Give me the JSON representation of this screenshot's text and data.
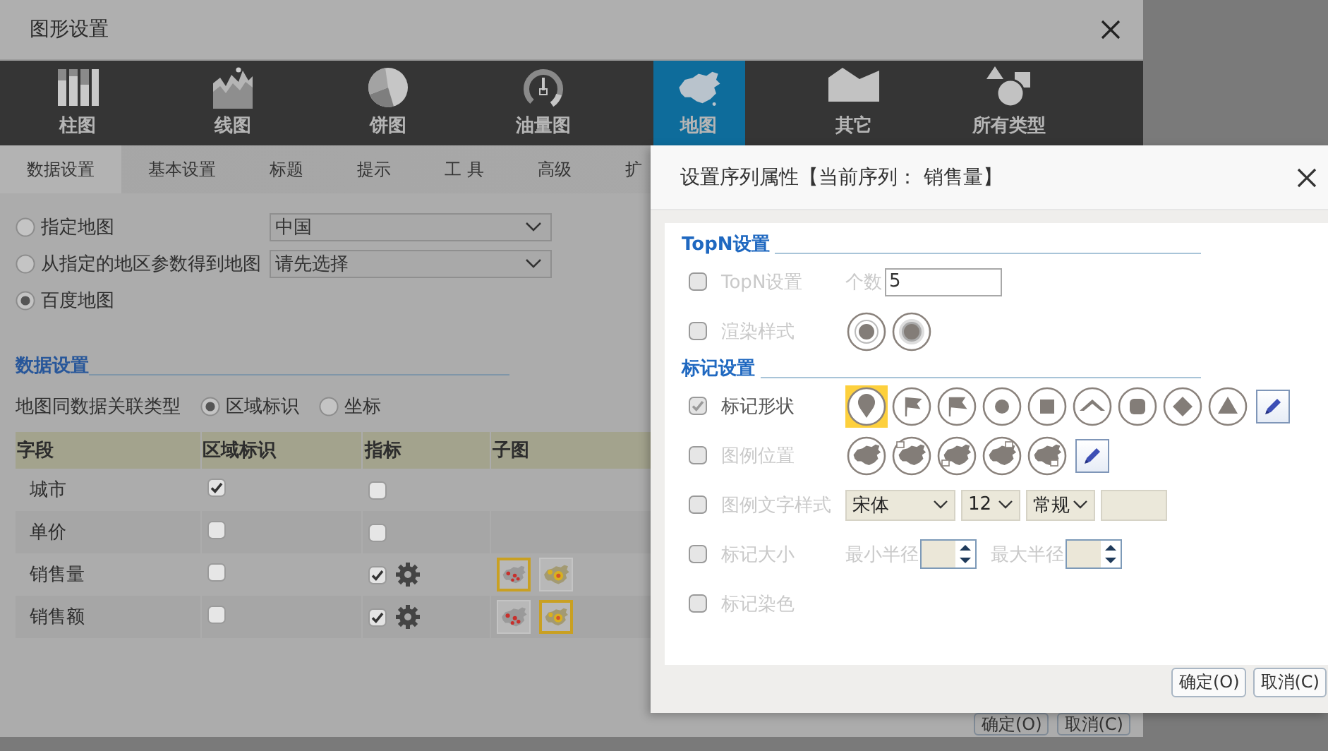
{
  "background_dialog": {
    "title": "图形设置",
    "chart_types": [
      {
        "kind": "bar",
        "label": "柱图",
        "selected": false
      },
      {
        "kind": "line",
        "label": "线图",
        "selected": false
      },
      {
        "kind": "pie",
        "label": "饼图",
        "selected": false
      },
      {
        "kind": "gauge",
        "label": "油量图",
        "selected": false
      },
      {
        "kind": "map",
        "label": "地图",
        "selected": true
      },
      {
        "kind": "other",
        "label": "其它",
        "selected": false
      },
      {
        "kind": "all",
        "label": "所有类型",
        "selected": false
      }
    ],
    "tabs": [
      {
        "label": "数据设置",
        "selected": true
      },
      {
        "label": "基本设置",
        "selected": false
      },
      {
        "label": "标题",
        "selected": false
      },
      {
        "label": "提示",
        "selected": false
      },
      {
        "label": "工 具",
        "selected": false
      },
      {
        "label": "高级",
        "selected": false
      },
      {
        "label": "扩",
        "selected": false
      }
    ],
    "map_sources": [
      {
        "label": "指定地图",
        "selected": false,
        "dropdown": "中国"
      },
      {
        "label": "从指定的地区参数得到地图",
        "selected": false,
        "dropdown": "请先选择"
      },
      {
        "label": "百度地图",
        "selected": true
      }
    ],
    "data_section": {
      "title": "数据设置",
      "link_type_label": "地图同数据关联类型",
      "link_types": [
        {
          "label": "区域标识",
          "selected": true
        },
        {
          "label": "坐标",
          "selected": false
        }
      ]
    },
    "table": {
      "columns": [
        "字段",
        "区域标识",
        "指标",
        "子图"
      ],
      "rows": [
        {
          "field": "城市",
          "region": true,
          "indicator": false
        },
        {
          "field": "单价",
          "region": false,
          "indicator": false
        },
        {
          "field": "销售量",
          "region": false,
          "indicator": true,
          "subcharts": [
            {
              "kind": "points",
              "selected": true
            },
            {
              "kind": "heat",
              "selected": false
            }
          ]
        },
        {
          "field": "销售额",
          "region": false,
          "indicator": true,
          "subcharts": [
            {
              "kind": "points",
              "selected": false
            },
            {
              "kind": "heat",
              "selected": true
            }
          ]
        }
      ]
    },
    "buttons": [
      "确定(O)",
      "取消(C)"
    ]
  },
  "series_dialog": {
    "title": "设置序列属性【当前序列： 销售量】",
    "sections": [
      {
        "title": "TopN设置",
        "rows": [
          {
            "kind": "topn",
            "label": "TopN设置",
            "checked": false,
            "count_label": "个数",
            "count_value": "5"
          },
          {
            "kind": "render",
            "label": "渲染样式",
            "checked": false,
            "options": [
              {
                "kind": "ring"
              },
              {
                "kind": "glow"
              }
            ]
          }
        ]
      },
      {
        "title": "标记设置",
        "rows": [
          {
            "kind": "shape",
            "label": "标记形状",
            "checked": true,
            "options": [
              {
                "kind": "pin",
                "selected": true
              },
              {
                "kind": "flag",
                "selected": false
              },
              {
                "kind": "pennant",
                "selected": false
              },
              {
                "kind": "circle",
                "selected": false
              },
              {
                "kind": "square",
                "selected": false
              },
              {
                "kind": "chevron",
                "selected": false
              },
              {
                "kind": "rounded",
                "selected": false
              },
              {
                "kind": "diamond",
                "selected": false
              },
              {
                "kind": "triangle",
                "selected": false
              }
            ]
          },
          {
            "kind": "legend_position",
            "label": "图例位置",
            "checked": false,
            "options": [
              {
                "kind": "none"
              },
              {
                "kind": "top-left"
              },
              {
                "kind": "bottom-left"
              },
              {
                "kind": "top-right"
              },
              {
                "kind": "bottom-right"
              }
            ]
          },
          {
            "kind": "legend_font",
            "label": "图例文字样式",
            "checked": false,
            "font": "宋体",
            "size": "12",
            "style": "常规"
          },
          {
            "kind": "size",
            "label": "标记大小",
            "checked": false,
            "min_label": "最小半径",
            "max_label": "最大半径"
          },
          {
            "kind": "color",
            "label": "标记染色",
            "checked": false
          }
        ]
      }
    ],
    "buttons": [
      "确定(O)",
      "取消(C)"
    ]
  }
}
